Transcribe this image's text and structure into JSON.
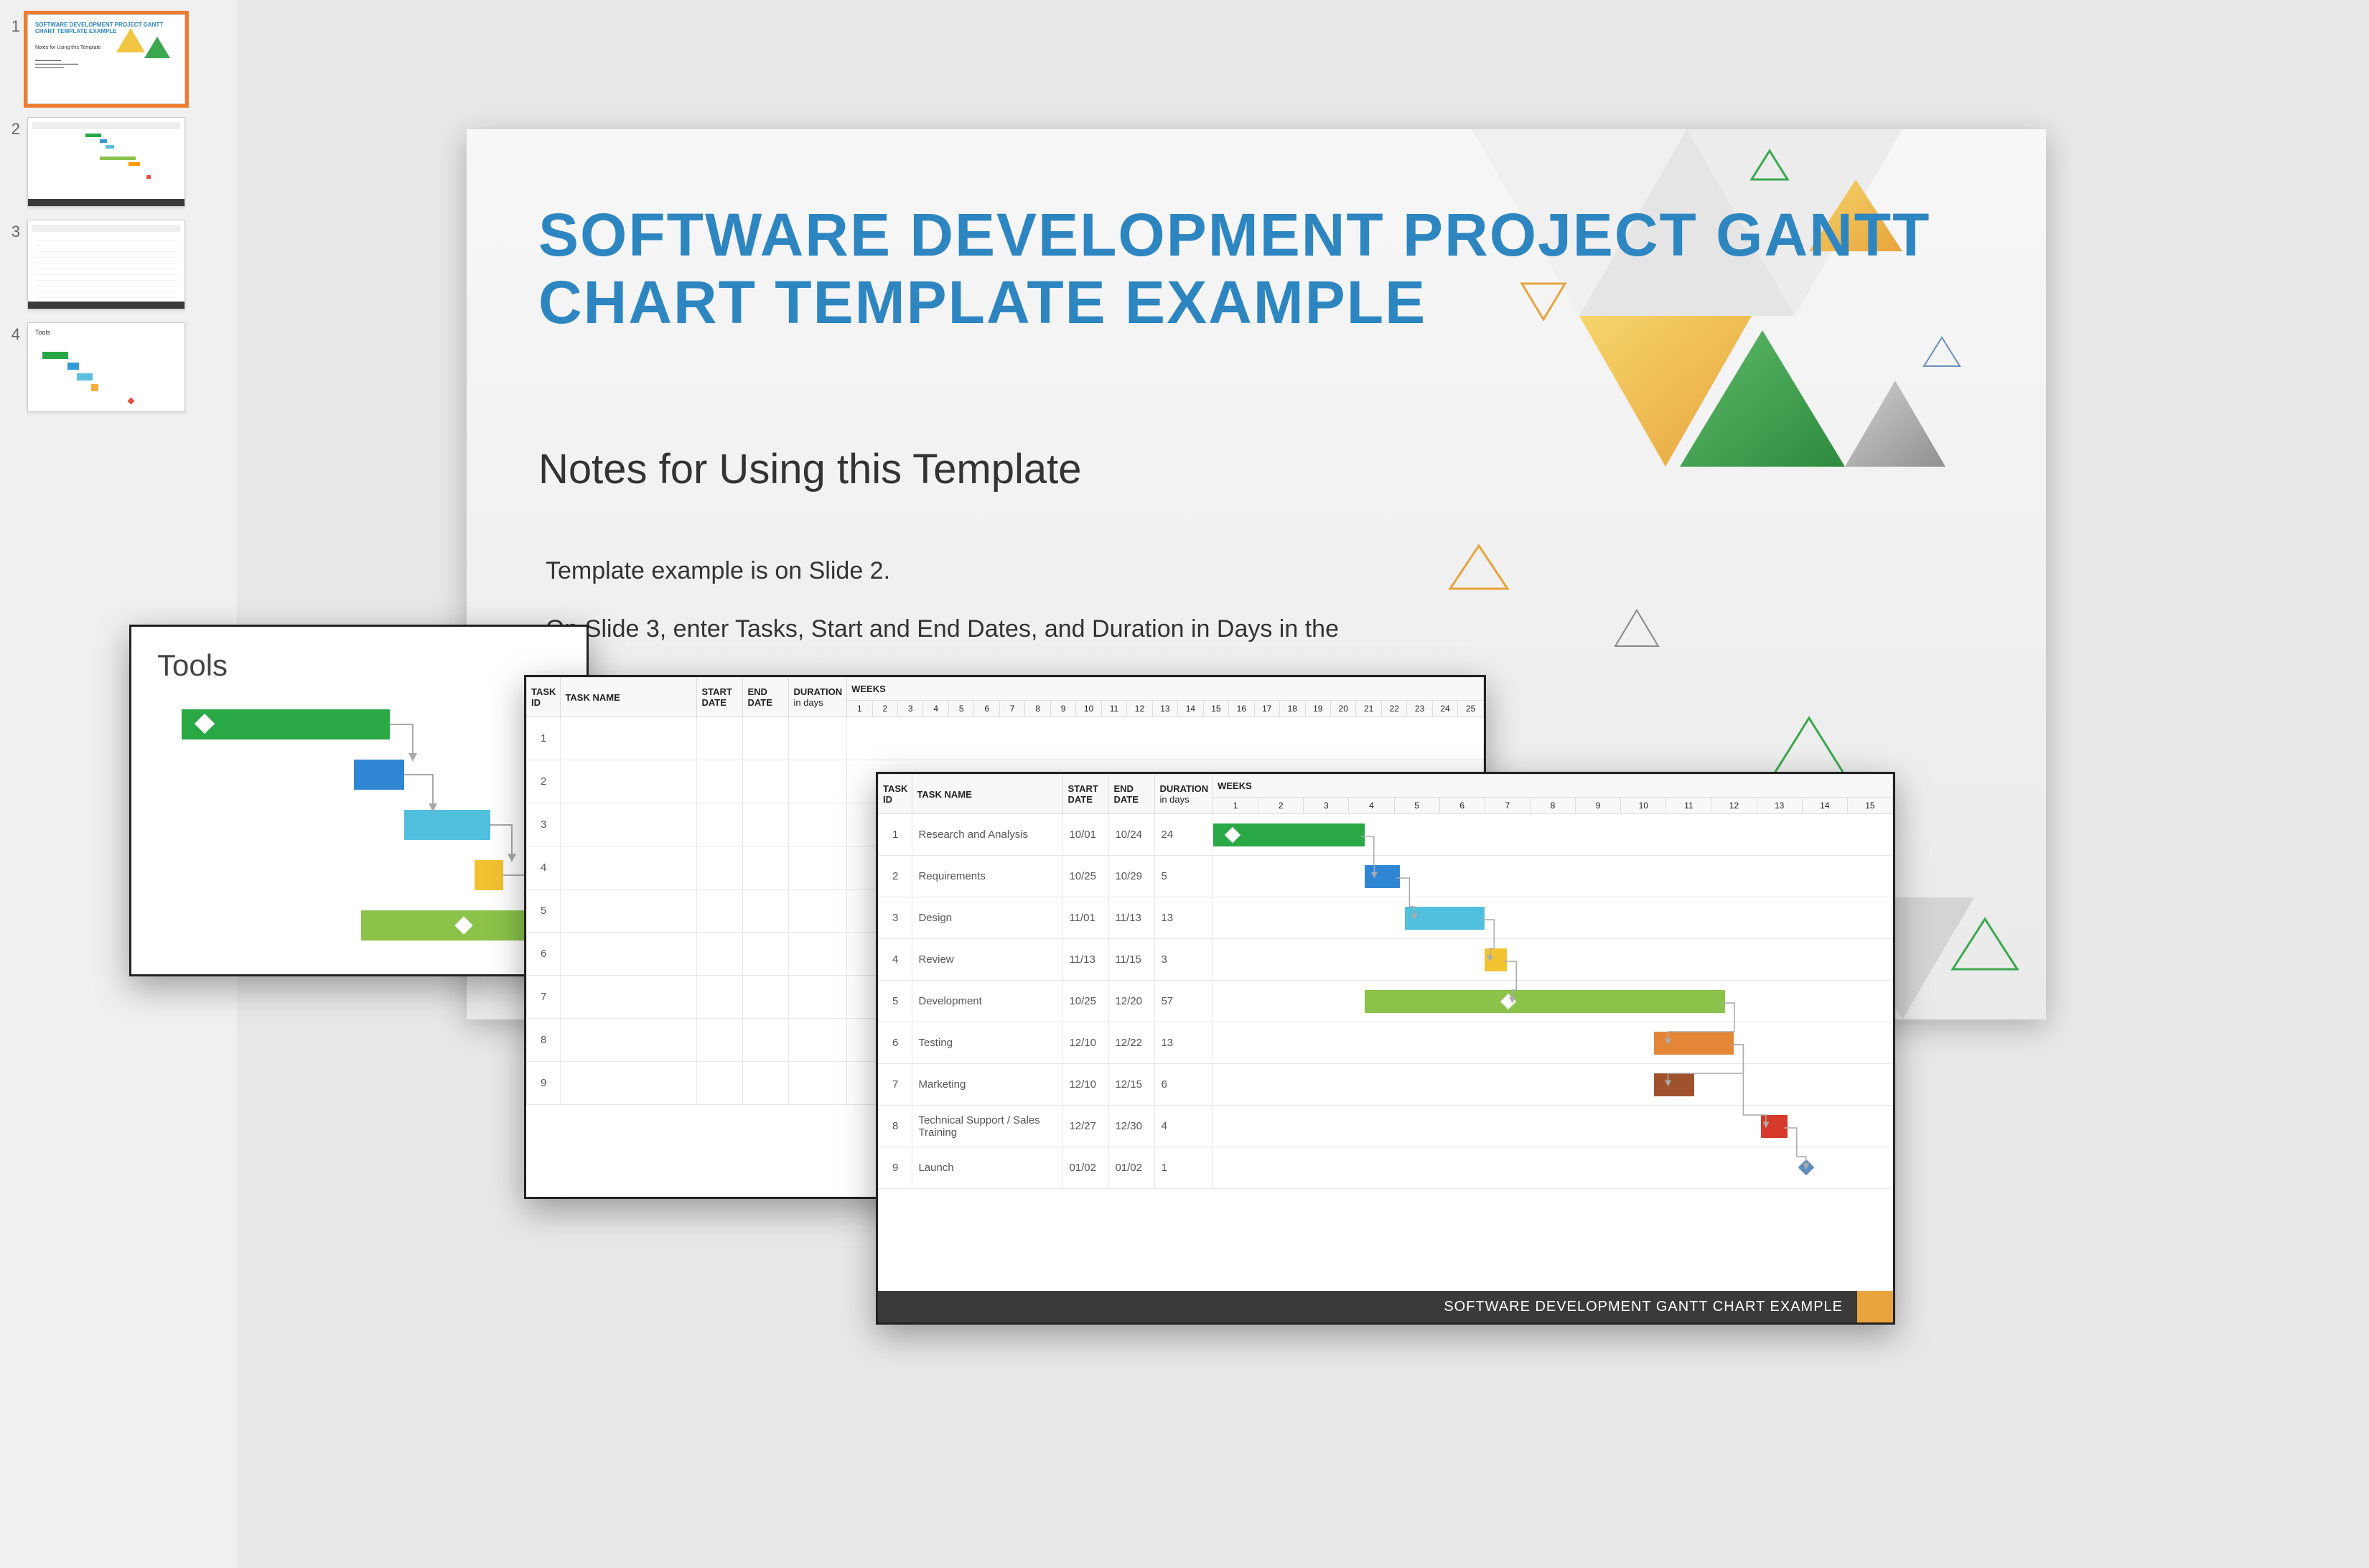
{
  "thumbs": [
    {
      "num": "1",
      "selected": true
    },
    {
      "num": "2",
      "selected": false
    },
    {
      "num": "3",
      "selected": false
    },
    {
      "num": "4",
      "selected": false
    }
  ],
  "main": {
    "title": "SOFTWARE DEVELOPMENT PROJECT GANTT CHART TEMPLATE EXAMPLE",
    "subtitle": "Notes for Using this Template",
    "body_line1": "Template example is on Slide 2.",
    "body_line2": "On Slide 3, enter Tasks, Start and End Dates, and Duration in Days in the"
  },
  "card_a": {
    "title": "Tools"
  },
  "table_headers": {
    "task_id": "TASK ID",
    "task_name": "TASK NAME",
    "start_date": "START DATE",
    "end_date": "END DATE",
    "duration": "DURATION",
    "duration_sub": "in days",
    "weeks": "WEEKS"
  },
  "blank_rows": [
    "1",
    "2",
    "3",
    "4",
    "5",
    "6",
    "7",
    "8",
    "9"
  ],
  "blank_weeks": [
    "1",
    "2",
    "3",
    "4",
    "5",
    "6",
    "7",
    "8",
    "9",
    "10",
    "11",
    "12",
    "13",
    "14",
    "15",
    "16",
    "17",
    "18",
    "19",
    "20",
    "21",
    "22",
    "23",
    "24",
    "25"
  ],
  "chart_data": {
    "type": "bar",
    "title": "SOFTWARE DEVELOPMENT GANTT CHART EXAMPLE",
    "xlabel": "WEEKS",
    "ylabel": "",
    "weeks": [
      "1",
      "2",
      "3",
      "4",
      "5",
      "6",
      "7",
      "8",
      "9",
      "10",
      "11",
      "12",
      "13",
      "14",
      "15"
    ],
    "columns": [
      "TASK ID",
      "TASK NAME",
      "START DATE",
      "END DATE",
      "DURATION in days"
    ],
    "rows": [
      {
        "id": "1",
        "name": "Research and Analysis",
        "start": "10/01",
        "end": "10/24",
        "dur": "24",
        "bar_start": 1,
        "bar_span": 3.4,
        "color": "green",
        "diamond": true
      },
      {
        "id": "2",
        "name": "Requirements",
        "start": "10/25",
        "end": "10/29",
        "dur": "5",
        "bar_start": 4.4,
        "bar_span": 0.8,
        "color": "blue"
      },
      {
        "id": "3",
        "name": "Design",
        "start": "11/01",
        "end": "11/13",
        "dur": "13",
        "bar_start": 5.3,
        "bar_span": 1.8,
        "color": "cyan"
      },
      {
        "id": "4",
        "name": "Review",
        "start": "11/13",
        "end": "11/15",
        "dur": "3",
        "bar_start": 7.1,
        "bar_span": 0.5,
        "color": "yellow"
      },
      {
        "id": "5",
        "name": "Development",
        "start": "10/25",
        "end": "12/20",
        "dur": "57",
        "bar_start": 4.4,
        "bar_span": 8.1,
        "color": "lime",
        "diamond": true,
        "diamond_at": 7.5
      },
      {
        "id": "6",
        "name": "Testing",
        "start": "12/10",
        "end": "12/22",
        "dur": "13",
        "bar_start": 10.9,
        "bar_span": 1.8,
        "color": "orange"
      },
      {
        "id": "7",
        "name": "Marketing",
        "start": "12/10",
        "end": "12/15",
        "dur": "6",
        "bar_start": 10.9,
        "bar_span": 0.9,
        "color": "brown"
      },
      {
        "id": "8",
        "name": "Technical Support / Sales Training",
        "start": "12/27",
        "end": "12/30",
        "dur": "4",
        "bar_start": 13.3,
        "bar_span": 0.6,
        "color": "red"
      },
      {
        "id": "9",
        "name": "Launch",
        "start": "01/02",
        "end": "01/02",
        "dur": "1",
        "bar_start": 14.2,
        "bar_span": 0,
        "color": "diamond"
      }
    ]
  },
  "thumb_titles": {
    "t1_title": "SOFTWARE DEVELOPMENT PROJECT GANTT CHART TEMPLATE EXAMPLE",
    "t1_sub": "Notes for Using this Template",
    "t4_title": "Tools"
  }
}
